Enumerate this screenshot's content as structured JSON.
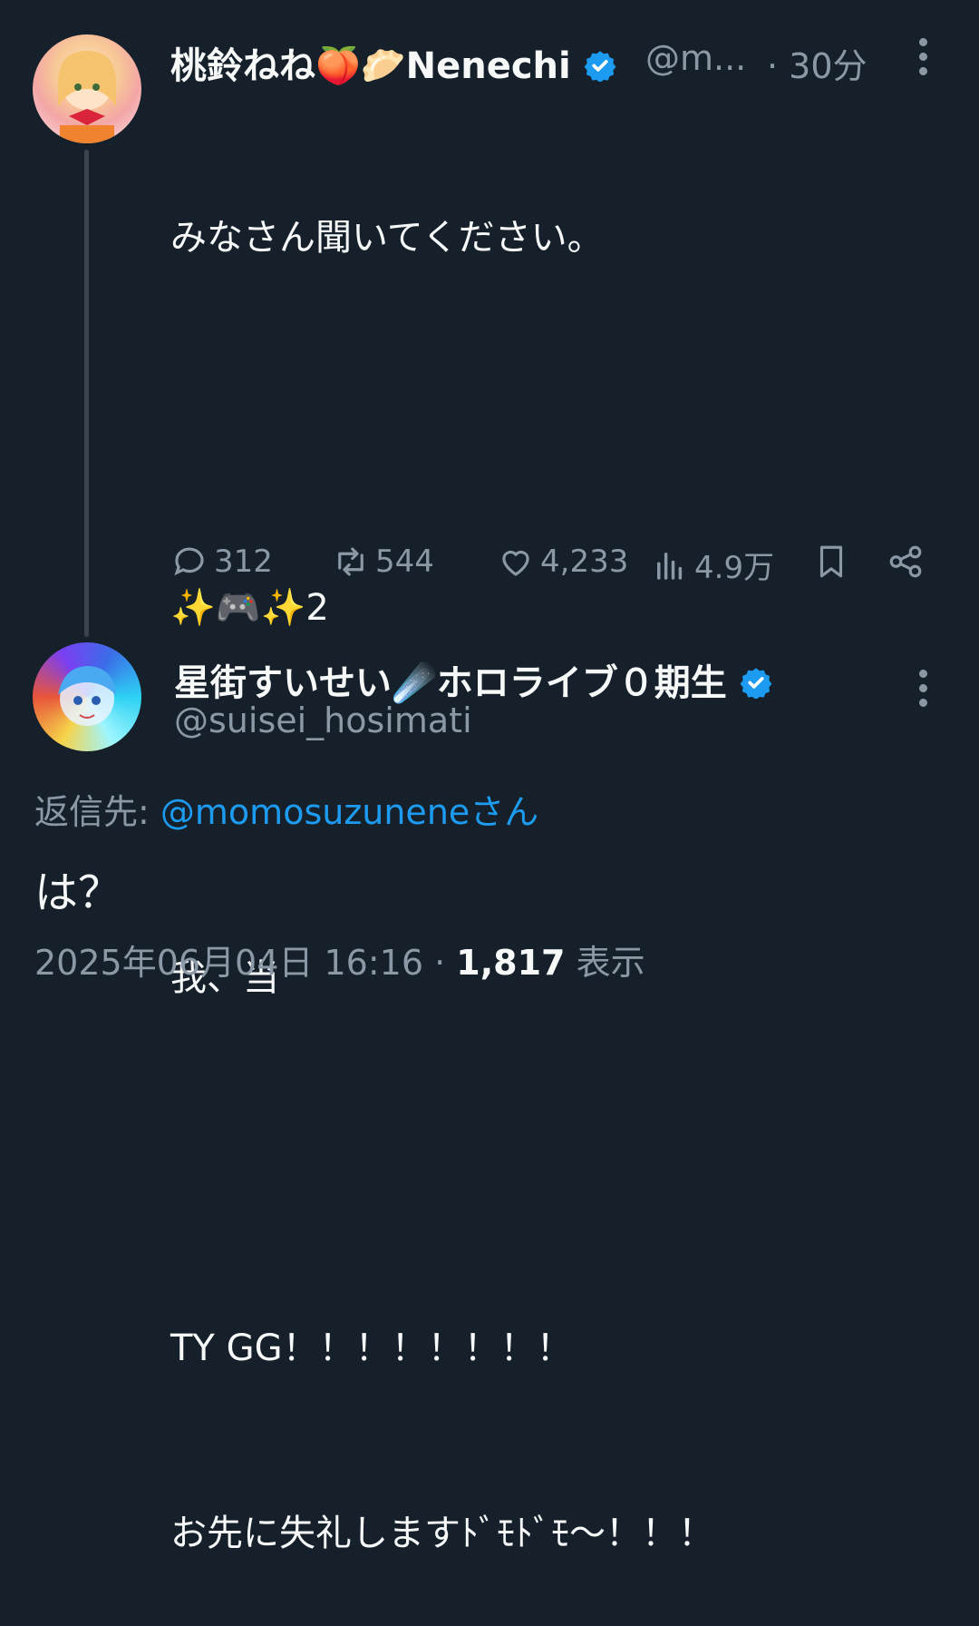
{
  "tweet1": {
    "display_name": "桃鈴ねね🍑🥟Nenechi",
    "handle": "@m...",
    "time": "· 30分",
    "lines": [
      "みなさん聞いてください。",
      "",
      "✨🎮✨2",
      "",
      "我、当",
      "",
      "TY GG！！！！！！！！",
      "お先に失礼しますﾄﾞﾓﾄﾞﾓ〜！！！"
    ],
    "replies": "312",
    "retweets": "544",
    "likes": "4,233",
    "views": "4.9万"
  },
  "tweet2": {
    "display_name": "星街すいせい☄️ホロライブ０期生",
    "handle": "@suisei_hosimati",
    "reply_to_label": "返信先:",
    "reply_to_handle": "@momosuzunene",
    "reply_to_suffix": "さん",
    "text": "は？",
    "timestamp": "2025年06月04日 16:16",
    "separator": "·",
    "view_count": "1,817",
    "view_label": "表示"
  },
  "colors": {
    "background": "#15202b",
    "text": "#f7f9f9",
    "muted": "#8b98a5",
    "accent": "#1d9bf0"
  }
}
